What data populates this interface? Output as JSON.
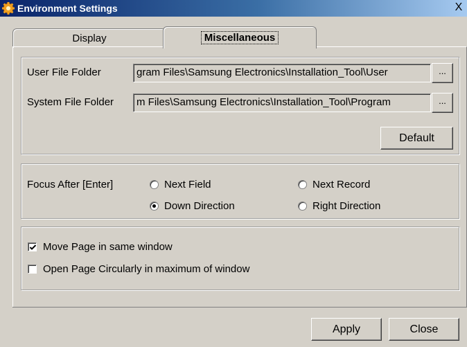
{
  "window": {
    "title": "Environment Settings",
    "close_glyph": "X"
  },
  "tabs": [
    {
      "label": "Display",
      "active": false
    },
    {
      "label": "Miscellaneous",
      "active": true
    }
  ],
  "folders": {
    "user_label": "User File Folder",
    "user_value": "gram Files\\Samsung Electronics\\Installation_Tool\\User",
    "system_label": "System File Folder",
    "system_value": "m Files\\Samsung Electronics\\Installation_Tool\\Program",
    "browse_label": "...",
    "default_label": "Default"
  },
  "focus": {
    "label": "Focus After [Enter]",
    "options": [
      {
        "label": "Next Field",
        "checked": false
      },
      {
        "label": "Next Record",
        "checked": false
      },
      {
        "label": "Down Direction",
        "checked": true
      },
      {
        "label": "Right Direction",
        "checked": false
      }
    ]
  },
  "options": [
    {
      "label": "Move Page in same window",
      "checked": true
    },
    {
      "label": "Open Page Circularly in maximum of window",
      "checked": false
    }
  ],
  "buttons": {
    "apply": "Apply",
    "close": "Close"
  },
  "colors": {
    "face": "#d4d0c8",
    "title_start": "#0a246a",
    "title_end": "#a6caf0"
  }
}
